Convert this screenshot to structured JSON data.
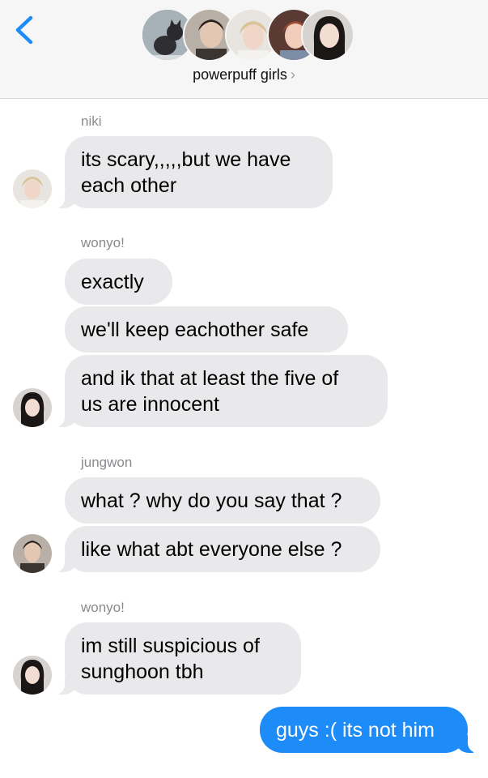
{
  "header": {
    "group_name": "powerpuff girls",
    "chevron": "›",
    "back_icon": "chevron-left-icon",
    "accent": "#1d8bf8",
    "participants": [
      "cat-photo-avatar",
      "jungwon-avatar",
      "niki-avatar",
      "member-avatar",
      "wonyo-avatar"
    ]
  },
  "colors": {
    "incoming_bubble": "#e9e9eb",
    "outgoing_bubble": "#1d8bf8",
    "sender_name": "#8a8a8e"
  },
  "messages": [
    {
      "sender": "niki",
      "lines": [
        "its scary,,,,,but we have",
        "each other"
      ]
    },
    {
      "sender": "wonyo!",
      "text_1": "exactly",
      "text_2": "we'll keep eachother safe",
      "lines": [
        "and ik that at least the five of",
        "us are innocent"
      ]
    },
    {
      "sender": "jungwon",
      "text_1": "what ? why do you say that ?",
      "text_2": "like what abt everyone else ?"
    },
    {
      "sender": "wonyo!",
      "lines": [
        "im still suspicious of",
        "sunghoon tbh"
      ]
    },
    {
      "sender": "me",
      "text": "guys :( its not him"
    }
  ]
}
